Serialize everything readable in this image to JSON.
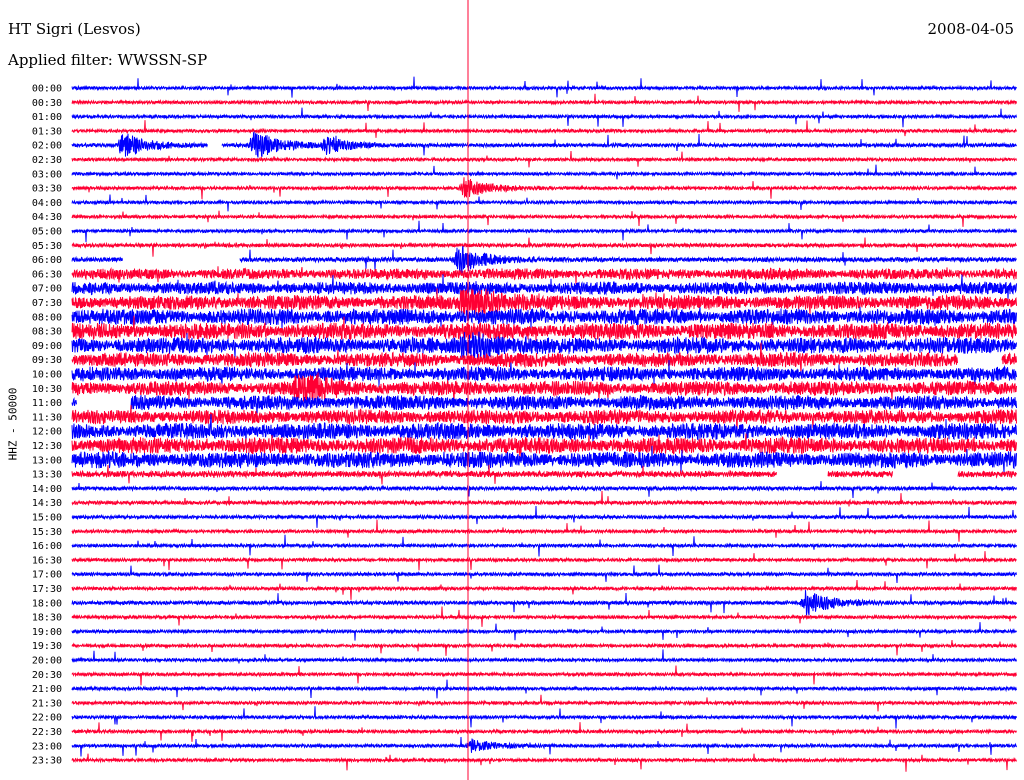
{
  "header": {
    "station": "HT Sigri (Lesvos)",
    "date": "2008-04-05",
    "filter": "Applied filter: WWSSN-SP",
    "channel": "HHZ - 50000"
  },
  "chart_data": {
    "type": "line",
    "title": "HT Sigri (Lesvos)",
    "subtitle": "Applied filter: WWSSN-SP",
    "ylabel": "HHZ - 50000",
    "xlabel": "",
    "grid": false,
    "colors": {
      "odd_traces": "#0000ff",
      "even_traces": "#ff0033",
      "marker_line": "#ff0033"
    },
    "row_labels": [
      "00:00",
      "00:30",
      "01:00",
      "01:30",
      "02:00",
      "02:30",
      "03:00",
      "03:30",
      "04:00",
      "04:30",
      "05:00",
      "05:30",
      "06:00",
      "06:30",
      "07:00",
      "07:30",
      "08:00",
      "08:30",
      "09:00",
      "09:30",
      "10:00",
      "10:30",
      "11:00",
      "11:30",
      "12:00",
      "12:30",
      "13:00",
      "13:30",
      "14:00",
      "14:30",
      "15:00",
      "15:30",
      "16:00",
      "16:30",
      "17:00",
      "17:30",
      "18:00",
      "18:30",
      "19:00",
      "19:30",
      "20:00",
      "20:30",
      "21:00",
      "21:30",
      "22:00",
      "22:30",
      "23:00",
      "23:30"
    ],
    "row_noise_level": [
      1,
      1,
      1,
      1,
      1.2,
      1,
      1,
      1,
      1,
      1,
      1,
      1.2,
      1.5,
      3,
      3.5,
      4,
      4.5,
      4.5,
      4.5,
      4,
      4,
      4,
      4,
      4,
      4.5,
      4.5,
      4.5,
      2,
      1.2,
      1.2,
      1.1,
      1,
      1,
      1,
      1.1,
      1,
      1.2,
      1,
      1,
      1,
      1,
      1,
      1,
      1,
      1,
      1,
      1,
      1
    ],
    "events": [
      {
        "row": "02:00",
        "minute": 3.5,
        "amplitude": 2.5
      },
      {
        "row": "02:00",
        "minute": 12.5,
        "amplitude": 3
      },
      {
        "row": "02:00",
        "minute": 17.5,
        "amplitude": 1.5
      },
      {
        "row": "03:30",
        "minute": 27,
        "amplitude": 2
      },
      {
        "row": "06:00",
        "minute": 26.5,
        "amplitude": 3
      },
      {
        "row": "07:30",
        "minute": 27,
        "amplitude": 5
      },
      {
        "row": "09:00",
        "minute": 27,
        "amplitude": 4
      },
      {
        "row": "10:30",
        "minute": 15.5,
        "amplitude": 3
      },
      {
        "row": "18:00",
        "minute": 50.5,
        "amplitude": 2.5
      },
      {
        "row": "23:00",
        "minute": 27.5,
        "amplitude": 1.2
      }
    ],
    "gaps": [
      {
        "row": "02:00",
        "from": 9.3,
        "to": 10.3
      },
      {
        "row": "06:00",
        "from": 3.5,
        "to": 11.5
      },
      {
        "row": "09:30",
        "from": 61,
        "to": 64
      },
      {
        "row": "11:00",
        "from": 0.3,
        "to": 4
      },
      {
        "row": "13:30",
        "from": 48.5,
        "to": 52
      },
      {
        "row": "13:30",
        "from": 56.5,
        "to": 61
      }
    ]
  }
}
